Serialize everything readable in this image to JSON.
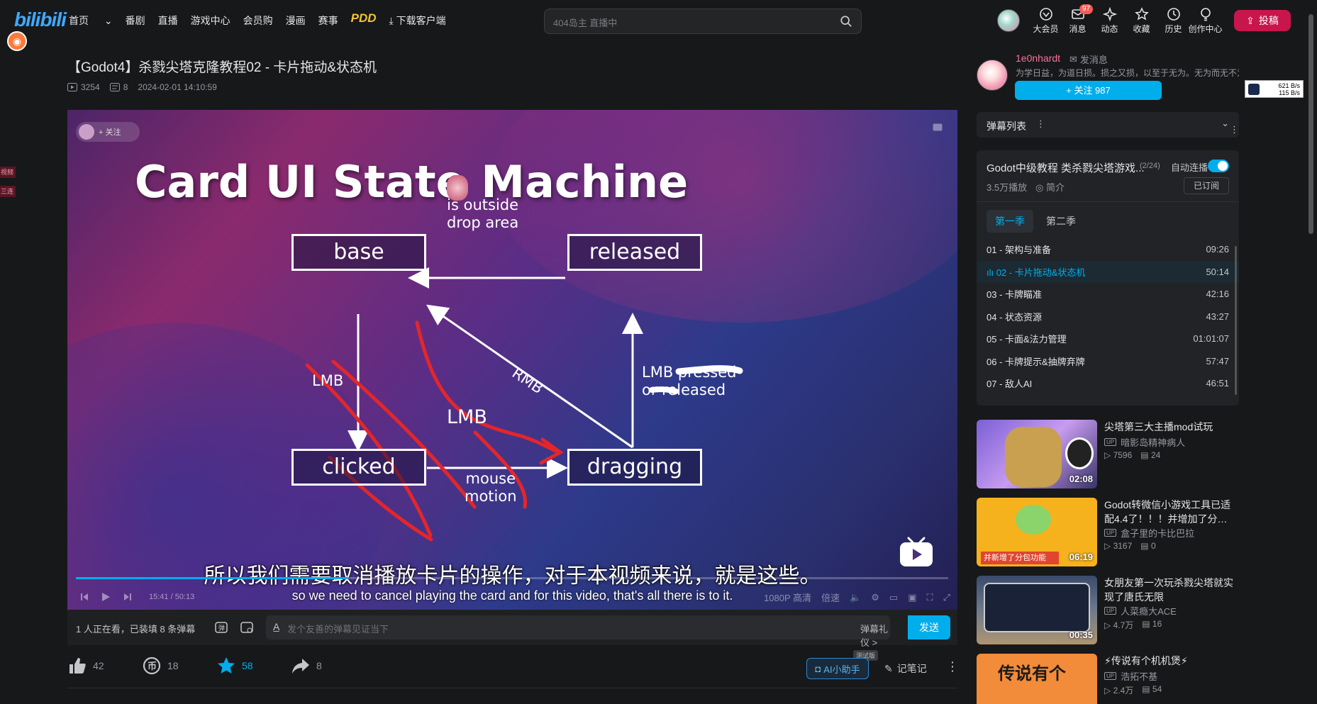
{
  "header": {
    "logo": "bilibili",
    "nav": [
      "首页",
      "番剧",
      "直播",
      "游戏中心",
      "会员购",
      "漫画",
      "赛事",
      "PDD",
      "下载客户端"
    ],
    "search_placeholder": "404岛主 直播中",
    "actions": [
      {
        "label": "大会员",
        "icon": "vip-icon"
      },
      {
        "label": "消息",
        "icon": "message-icon",
        "badge": "97"
      },
      {
        "label": "动态",
        "icon": "dynamic-icon"
      },
      {
        "label": "收藏",
        "icon": "favorite-icon"
      },
      {
        "label": "历史",
        "icon": "history-icon"
      },
      {
        "label": "创作中心",
        "icon": "creator-icon"
      }
    ],
    "upload": "投稿"
  },
  "video": {
    "title": "【Godot4】杀戮尖塔克隆教程02 - 卡片拖动&状态机",
    "views": "3254",
    "danmaku": "8",
    "date": "2024-02-01 14:10:59"
  },
  "side_tags": [
    "视频",
    "三连"
  ],
  "player": {
    "follow": "+ 关注",
    "slide_title": "Card UI State Machine",
    "states": {
      "base": "base",
      "released": "released",
      "clicked": "clicked",
      "dragging": "dragging"
    },
    "edges": {
      "outside": "is outside\ndrop area",
      "lmb_down": "LMB",
      "rmb": "RMB",
      "lmb_middle": "LMB",
      "lmb_pressed": "LMB pressed\nor released",
      "mouse_motion": "mouse\nmotion"
    },
    "subtitle_cn": "所以我们需要取消播放卡片的操作，对于本视频来说，就是这些。",
    "subtitle_en": "so we need to cancel playing the card and for this video, that's all there is to it.",
    "time": "15:41 / 50:13",
    "progress": 0.312,
    "controls": [
      "1080P 高清",
      "倍速"
    ]
  },
  "danmaku_bar": {
    "info": "1 人正在看，已装填 8 条弹幕",
    "placeholder": "发个友善的弹幕见证当下",
    "etiquette": "弹幕礼仪 >",
    "send": "发送"
  },
  "action_bar": {
    "like": "42",
    "coin": "18",
    "favorite": "58",
    "share": "8",
    "ai": "AI小助手",
    "ai_tag": "测试版",
    "note": "记笔记"
  },
  "uploader": {
    "name": "1e0nhardt",
    "message": "发消息",
    "desc": "为学日益，为道日损。损之又损，以至于无为。无为而无不为",
    "follow": "+ 关注 987"
  },
  "net_speed": {
    "up": "621 B/s",
    "down": "115 B/s"
  },
  "danmaku_list": "弹幕列表",
  "playlist": {
    "title": "Godot中级教程 类杀戮尖塔游戏...",
    "count": "(2/24)",
    "auto": "自动连播",
    "plays": "3.5万播放",
    "intro": "简介",
    "subscribed": "已订阅",
    "seasons": [
      "第一季",
      "第二季"
    ],
    "episodes": [
      {
        "title": "01 - 架构与准备",
        "dur": "09:26"
      },
      {
        "title": "02 - 卡片拖动&状态机",
        "dur": "50:14",
        "active": true
      },
      {
        "title": "03 - 卡牌瞄准",
        "dur": "42:16"
      },
      {
        "title": "04 - 状态资源",
        "dur": "43:27"
      },
      {
        "title": "05 - 卡面&法力管理",
        "dur": "01:01:07"
      },
      {
        "title": "06 - 卡牌提示&抽牌弃牌",
        "dur": "57:47"
      },
      {
        "title": "07 - 敌人AI",
        "dur": "46:51"
      }
    ]
  },
  "recommendations": [
    {
      "title": "尖塔第三大主播mod试玩",
      "up": "暗影岛精神病人",
      "views": "7596",
      "dm": "24",
      "dur": "02:08"
    },
    {
      "title": "Godot转微信小游戏工具已适配4.4了！！！并增加了分…",
      "up": "盒子里的卡比巴拉",
      "views": "3167",
      "dm": "0",
      "dur": "06:19",
      "thumb_caption": "并新增了分包功能"
    },
    {
      "title": "女朋友第一次玩杀戮尖塔就实现了唐氏无限",
      "up": "人菜瘾大ACE",
      "views": "4.7万",
      "dm": "16",
      "dur": "00:35"
    },
    {
      "title": "⚡传说有个机机煲⚡",
      "up": "浩拓不基",
      "views": "2.4万",
      "dm": "54",
      "thumb_caption": "传说有个"
    }
  ],
  "colors": {
    "accent": "#00aeec",
    "pink": "#fb7299",
    "upload": "#c8154c"
  }
}
